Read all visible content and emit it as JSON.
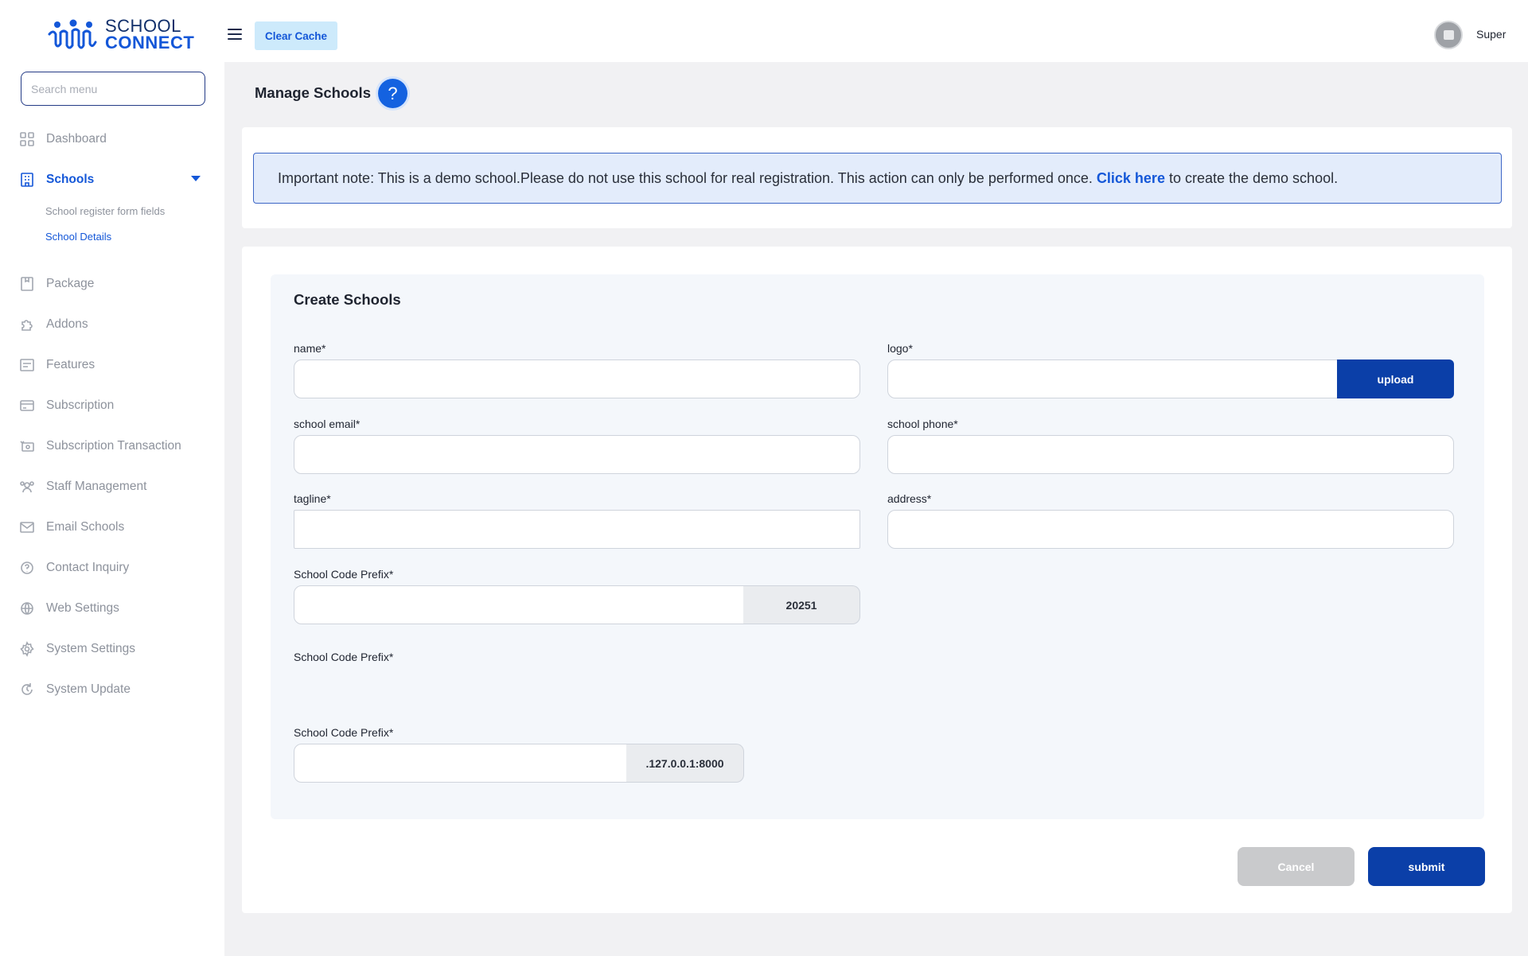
{
  "brand": {
    "line1": "SCHOOL",
    "line2": "CONNECT"
  },
  "sidebar": {
    "search_placeholder": "Search menu",
    "items": [
      {
        "label": "Dashboard",
        "icon": "dashboard-icon"
      },
      {
        "label": "Schools",
        "icon": "building-icon"
      },
      {
        "label": "Package",
        "icon": "package-icon"
      },
      {
        "label": "Addons",
        "icon": "puzzle-icon"
      },
      {
        "label": "Features",
        "icon": "features-icon"
      },
      {
        "label": "Subscription",
        "icon": "card-icon"
      },
      {
        "label": "Subscription Transaction",
        "icon": "transaction-icon"
      },
      {
        "label": "Staff Management",
        "icon": "staff-icon"
      },
      {
        "label": "Email Schools",
        "icon": "mail-icon"
      },
      {
        "label": "Contact Inquiry",
        "icon": "question-circle-icon"
      },
      {
        "label": "Web Settings",
        "icon": "globe-icon"
      },
      {
        "label": "System Settings",
        "icon": "gear-icon"
      },
      {
        "label": "System Update",
        "icon": "update-icon"
      }
    ],
    "schools_sub": [
      {
        "label": "School register form fields"
      },
      {
        "label": "School Details"
      }
    ]
  },
  "topbar": {
    "clear_cache": "Clear Cache",
    "username": "Super"
  },
  "page": {
    "title": "Manage Schools",
    "help": "?"
  },
  "notice": {
    "text_before": "Important note: This is a demo school.Please do not use this school for real registration. This action can only be performed once.",
    "link": "Click here",
    "text_after": "to create the demo school."
  },
  "form": {
    "title": "Create Schools",
    "name_label": "name*",
    "logo_label": "logo*",
    "upload_label": "upload",
    "email_label": "school email*",
    "phone_label": "school phone*",
    "tagline_label": "tagline*",
    "address_label": "address*",
    "prefix_label": "School Code Prefix*",
    "prefix_addon": "20251",
    "prefix_label_2": "School Code Prefix*",
    "prefix_label_3": "School Code Prefix*",
    "domain_addon": ".127.0.0.1:8000",
    "cancel_label": "Cancel",
    "submit_label": "submit"
  },
  "colors": {
    "accent": "#1457d8",
    "primary_button": "#0b3fa8",
    "notice_bg": "#e3ecfb",
    "clear_cache_bg": "#cdeafb"
  }
}
